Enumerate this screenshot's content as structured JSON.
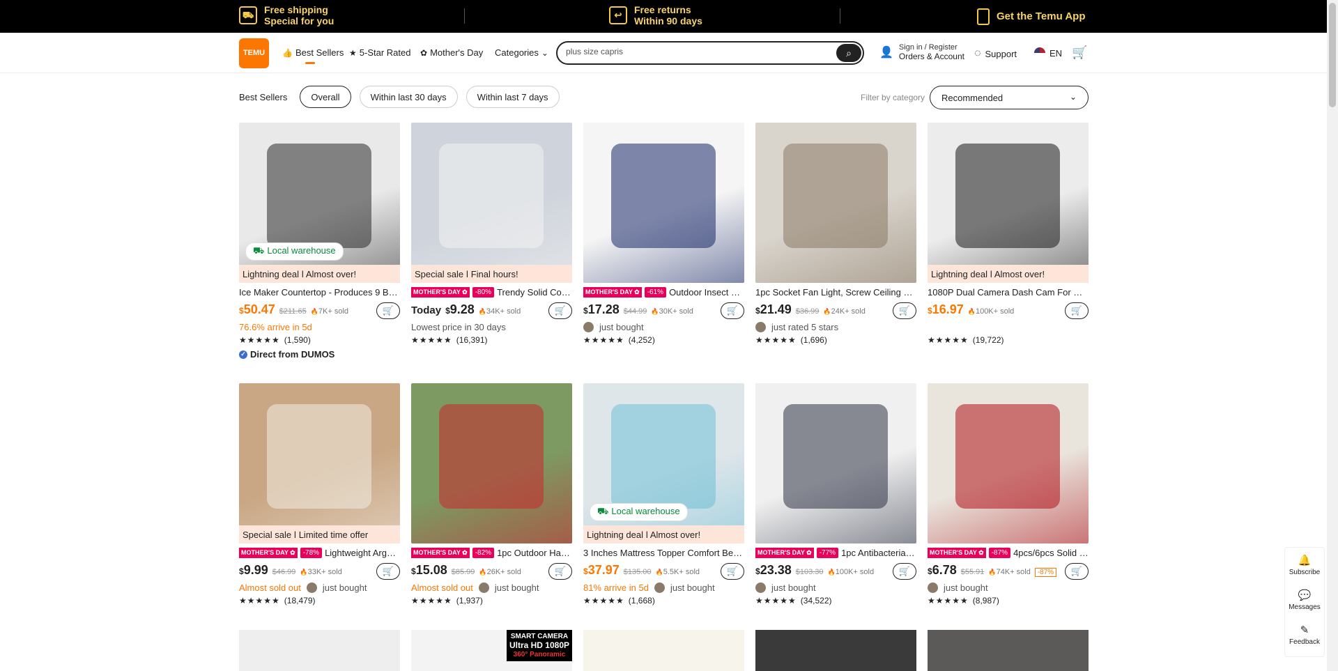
{
  "topbar": {
    "shipping_l1": "Free shipping",
    "shipping_l2": "Special for you",
    "returns_l1": "Free returns",
    "returns_l2": "Within 90 days",
    "app": "Get the Temu App"
  },
  "header": {
    "logo": "TEMU",
    "nav": {
      "best_sellers": "Best Sellers",
      "five_star": "5-Star Rated",
      "mothers_day": "Mother's Day",
      "categories": "Categories"
    },
    "search_value": "plus size capris",
    "sign_in": "Sign in / Register",
    "orders": "Orders & Account",
    "support": "Support",
    "lang": "EN"
  },
  "filters": {
    "label": "Best Sellers",
    "overall": "Overall",
    "last30": "Within last 30 days",
    "last7": "Within last 7 days",
    "category_label": "Filter by category",
    "sort": "Recommended"
  },
  "products": [
    {
      "title": "Ice Maker Countertop - Produces 9 Bull...",
      "price": "50.47",
      "old": "$211.65",
      "sold": "7K+ sold",
      "sub": "76.6% arrive in 5d",
      "rating": "(1,590)",
      "deal": "Lightning deal ǀ Almost over!",
      "brand": "Direct from DUMOS",
      "badge": "Local warehouse",
      "bg": "#e9e9e9",
      "accent": "#2b2b2b"
    },
    {
      "title": "Trendy Solid Color Strip...",
      "pre": "Today",
      "price": "9.28",
      "old": "",
      "sold": "34K+ sold",
      "sub": "Lowest price in 30 days",
      "rating": "(16,391)",
      "deal": "Special sale ǀ Final hours!",
      "md": "-80%",
      "bg": "#cfd4dc",
      "accent": "#f2f2f2"
    },
    {
      "title": "Outdoor Insect Killer - E...",
      "price": "17.28",
      "old": "$44.99",
      "sold": "30K+ sold",
      "sub": "just bought",
      "rating": "(4,252)",
      "md": "-61%",
      "bg": "#f5f5f5",
      "accent": "#1a2a6a"
    },
    {
      "title": "1pc Socket Fan Light, Screw Ceiling Fan...",
      "price": "21.49",
      "old": "$36.99",
      "sold": "24K+ sold",
      "sub": "just rated 5 stars",
      "rating": "(1,696)",
      "bg": "#d9d4cc",
      "accent": "#8a7a66"
    },
    {
      "title": "1080P Dual Camera Dash Cam For Cars ...",
      "price": "16.97",
      "old": "",
      "sold": "100K+ sold",
      "sub": "",
      "rating": "(19,722)",
      "deal": "Lightning deal ǀ Almost over!",
      "bg": "#ececec",
      "accent": "#1a1a1a"
    },
    {
      "title": "Lightweight Argyle Patt...",
      "price": "9.99",
      "old": "$46.99",
      "sold": "33K+ sold",
      "sub": "Almost sold out",
      "sub2": "just bought",
      "rating": "(18,479)",
      "deal": "Special sale ǀ Limited time offer",
      "md": "-78%",
      "bg": "#c9a785",
      "accent": "#f1ece2"
    },
    {
      "title": "1pc Outdoor Hammock ...",
      "price": "15.08",
      "old": "$85.99",
      "sold": "26K+ sold",
      "sub": "Almost sold out",
      "sub2": "just bought",
      "rating": "(1,937)",
      "md": "-82%",
      "bg": "#7d9a63",
      "accent": "#c8282e"
    },
    {
      "title": "3 Inches Mattress Topper Comfort Bed ...",
      "price": "37.97",
      "old": "$135.00",
      "sold": "5.5K+ sold",
      "sub": "81% arrive in 5d",
      "sub2": "just bought",
      "rating": "(1,668)",
      "deal": "Lightning deal ǀ Almost over!",
      "badge": "Local warehouse",
      "bg": "#dfe6ea",
      "accent": "#6fc0d6"
    },
    {
      "title": "1pc Antibacterial Knitte...",
      "price": "23.38",
      "old": "$103.30",
      "sold": "100K+ sold",
      "sub": "just bought",
      "rating": "(34,522)",
      "md": "-77%",
      "bg": "#f0f0f0",
      "accent": "#2f3345"
    },
    {
      "title": "4pcs/6pcs Solid Color B...",
      "price": "6.78",
      "old": "$55.91",
      "sold": "74K+ sold",
      "pct": "-87%",
      "sub": "just bought",
      "rating": "(8,987)",
      "md": "-87%",
      "bg": "#e9e4dc",
      "accent": "#b0121b"
    }
  ],
  "row3_labels": {
    "smart_camera": "SMART CAMERA",
    "ultra": "Ultra HD 1080P",
    "panoramic": "360° Panoramic"
  },
  "side": {
    "subscribe": "Subscribe",
    "messages": "Messages",
    "feedback": "Feedback"
  },
  "colors": {
    "brand": "#fb7701",
    "md_pink": "#e8005a"
  }
}
